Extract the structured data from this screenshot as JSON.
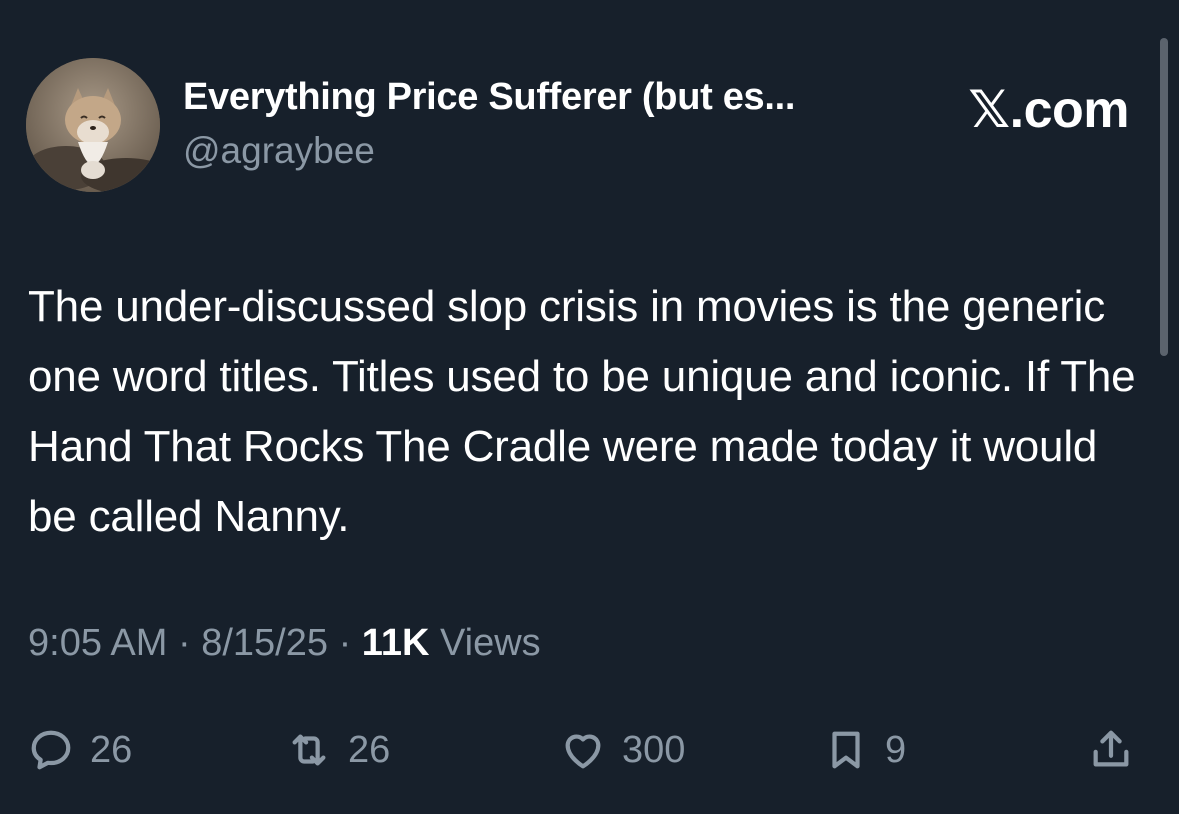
{
  "author": {
    "display_name": "Everything Price Sufferer (but es...",
    "handle": "@agraybee",
    "avatar_icon": "fox-avatar"
  },
  "brand": {
    "label": "𝕏.com"
  },
  "tweet": {
    "text": "The under-discussed slop crisis in movies is the generic one word titles. Titles used to be unique and iconic. If The Hand That Rocks The Cradle were made today it would be called Nanny.",
    "time": "9:05 AM",
    "date": "8/15/25",
    "views_count": "11K",
    "views_label": "Views",
    "separator": "·"
  },
  "actions": {
    "replies": "26",
    "reposts": "26",
    "likes": "300",
    "bookmarks": "9",
    "reply_icon": "reply-icon",
    "repost_icon": "repost-icon",
    "like_icon": "heart-icon",
    "bookmark_icon": "bookmark-icon",
    "share_icon": "share-icon"
  },
  "colors": {
    "background": "#17202b",
    "primary_text": "#ffffff",
    "secondary_text": "#8b98a5"
  }
}
